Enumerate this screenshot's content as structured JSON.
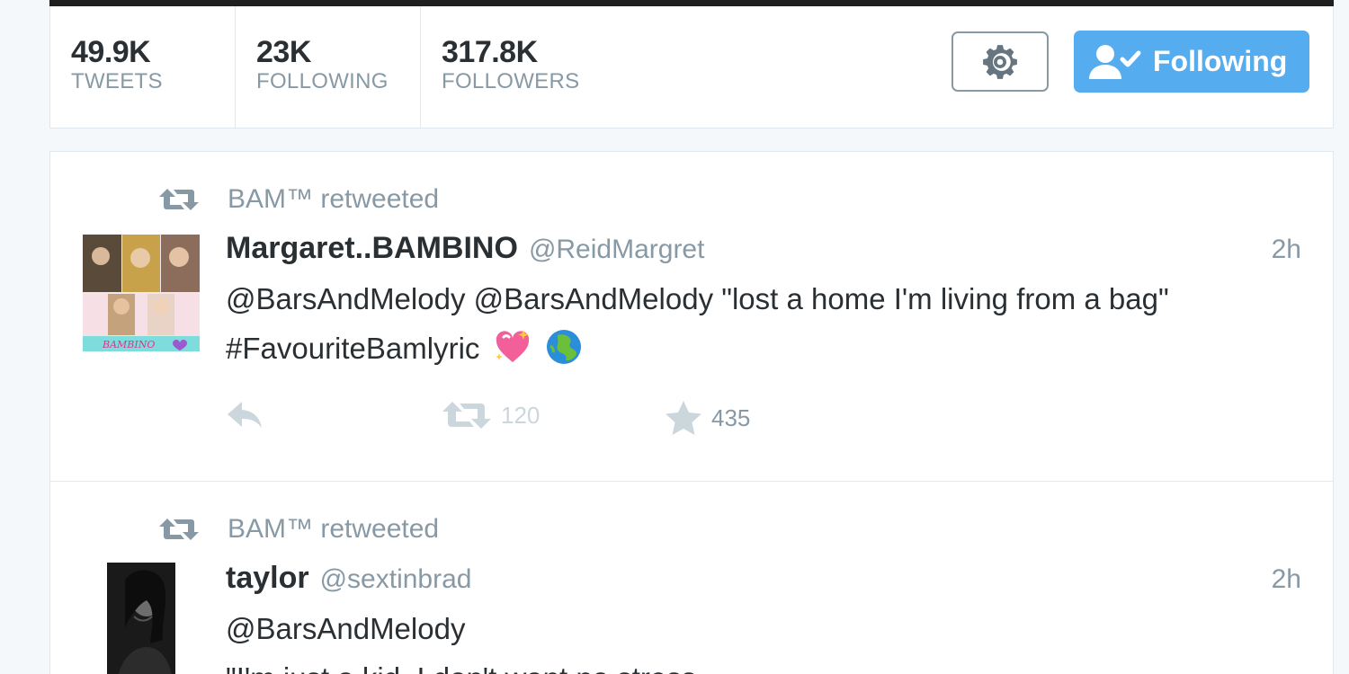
{
  "profile_nav": {
    "stats": [
      {
        "value": "49.9K",
        "label": "TWEETS"
      },
      {
        "value": "23K",
        "label": "FOLLOWING"
      },
      {
        "value": "317.8K",
        "label": "FOLLOWERS"
      }
    ],
    "settings_icon": "gear-icon",
    "follow_button_label": "Following",
    "follow_button_icon": "user-check-icon"
  },
  "colors": {
    "accent": "#55acee",
    "muted_text": "#8899a6",
    "primary_text": "#292f33",
    "border": "#e1e8ed"
  },
  "timeline": {
    "tweets": [
      {
        "retweeted_by": "BAM™ retweeted",
        "fullname": "Margaret..BAMBINO",
        "username": "@ReidMargret",
        "time": "2h",
        "text_line1": "@BarsAndMelody @BarsAndMelody \"lost a home I'm living from a bag\"",
        "text_line2": "#FavouriteBamlyric",
        "emojis": [
          "sparkling-heart",
          "globe-asia"
        ],
        "avatar_caption": "BAMBINO",
        "actions": {
          "reply_icon": "reply-icon",
          "retweet_icon": "retweet-icon",
          "retweet_count": "120",
          "favorite_icon": "star-icon",
          "favorite_count": "435"
        }
      },
      {
        "retweeted_by": "BAM™ retweeted",
        "fullname": "taylor",
        "username": "@sextinbrad",
        "time": "2h",
        "text_line1": "@BarsAndMelody",
        "text_line2": "\"I'm just a kid, I don't want no stress"
      }
    ]
  }
}
